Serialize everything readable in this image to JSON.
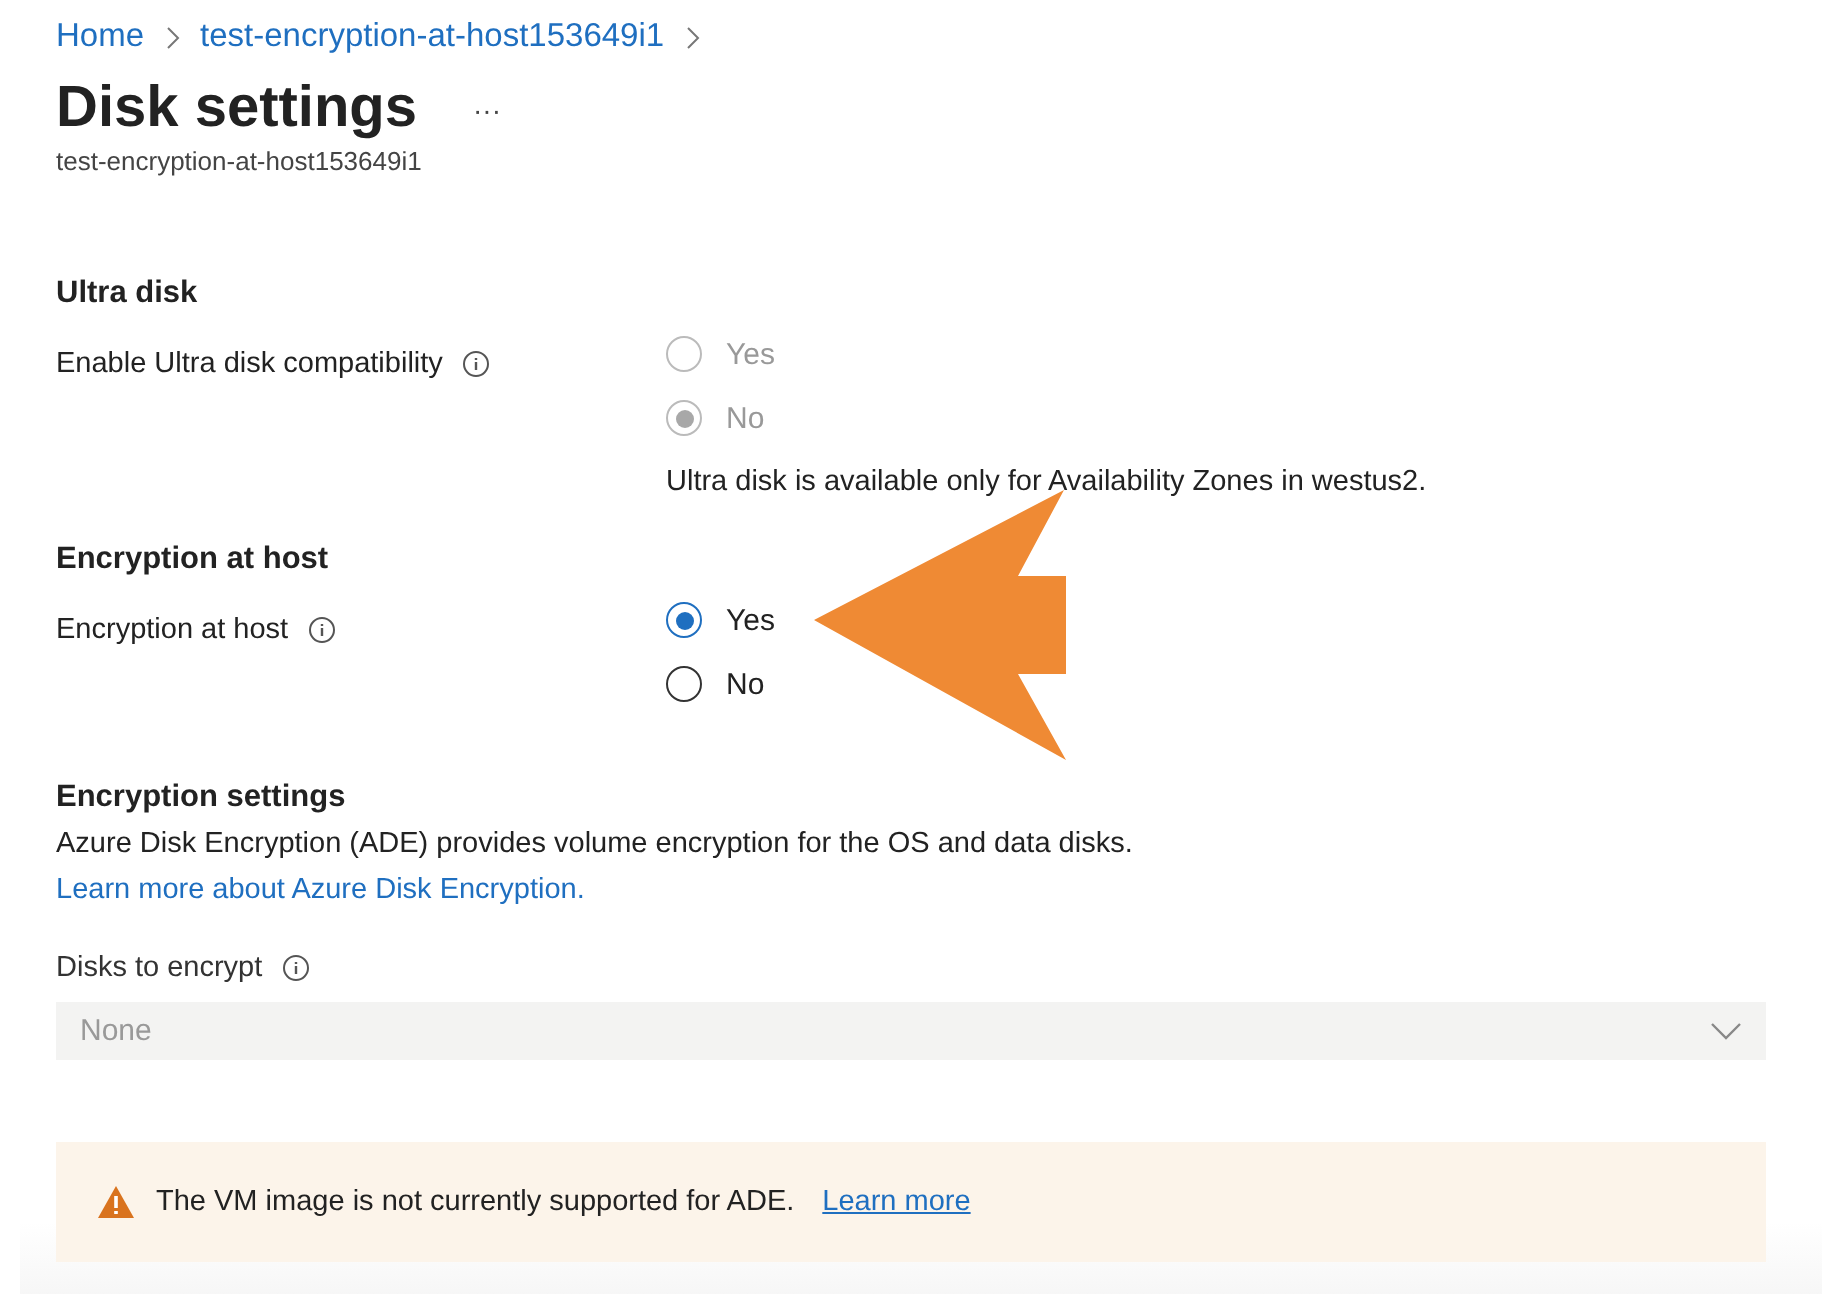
{
  "breadcrumb": [
    {
      "label": "Home"
    },
    {
      "label": "test-encryption-at-host153649i1"
    }
  ],
  "title": "Disk settings",
  "more_icon": "···",
  "subtitle": "test-encryption-at-host153649i1",
  "sections": [
    {
      "heading": "Ultra disk",
      "label": "Enable Ultra disk compatibility",
      "disabled": true,
      "options": [
        {
          "label": "Yes",
          "selected": false
        },
        {
          "label": "No",
          "selected": true
        }
      ],
      "note": "Ultra disk is available only for Availability Zones in westus2."
    },
    {
      "heading": "Encryption at host",
      "label": "Encryption at host",
      "disabled": false,
      "options": [
        {
          "label": "Yes",
          "selected": true
        },
        {
          "label": "No",
          "selected": false
        }
      ]
    }
  ],
  "encryption_settings": {
    "heading": "Encryption settings",
    "description": "Azure Disk Encryption (ADE) provides volume encryption for the OS and data disks.",
    "link": "Learn more about Azure Disk Encryption.",
    "field_label": "Disks to encrypt",
    "dropdown": {
      "value": "None",
      "disabled": true
    }
  },
  "warning": {
    "text": "The VM image is not currently supported for ADE.",
    "link": "Learn more"
  }
}
